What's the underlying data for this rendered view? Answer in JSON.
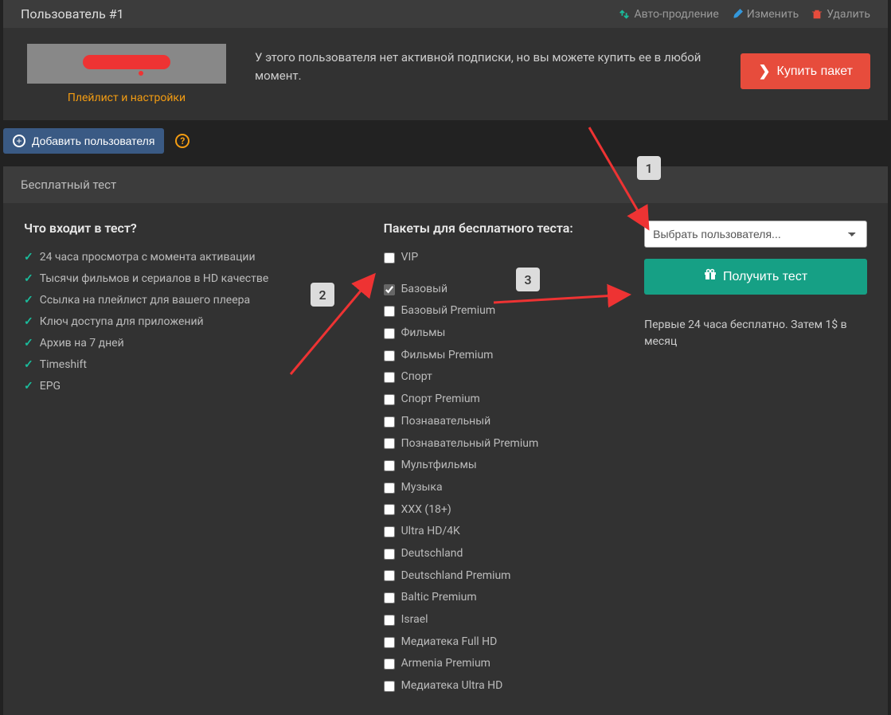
{
  "user": {
    "title": "Пользователь #1",
    "links": {
      "auto": "Авто-продление",
      "edit": "Изменить",
      "delete": "Удалить"
    },
    "playlist_link": "Плейлист и настройки",
    "subscription_text": "У этого пользователя нет активной подписки, но вы можете купить ее в любой момент.",
    "buy_label": "Купить пакет"
  },
  "add_user_label": "Добавить пользователя",
  "test": {
    "header": "Бесплатный тест",
    "includes_title": "Что входит в тест?",
    "features": [
      "24 часа просмотра с момента активации",
      "Тысячи фильмов и сериалов в HD качестве",
      "Ссылка на плейлист для вашего плеера",
      "Ключ доступа для приложений",
      "Архив на 7 дней",
      "Timeshift",
      "EPG"
    ],
    "packages_title": "Пакеты для бесплатного теста:",
    "packages": [
      {
        "label": "VIP",
        "checked": false
      },
      {
        "label": "Базовый",
        "checked": true
      },
      {
        "label": "Базовый Premium",
        "checked": false
      },
      {
        "label": "Фильмы",
        "checked": false
      },
      {
        "label": "Фильмы Premium",
        "checked": false
      },
      {
        "label": "Спорт",
        "checked": false
      },
      {
        "label": "Спорт Premium",
        "checked": false
      },
      {
        "label": "Познавательный",
        "checked": false
      },
      {
        "label": "Познавательный Premium",
        "checked": false
      },
      {
        "label": "Мультфильмы",
        "checked": false
      },
      {
        "label": "Музыка",
        "checked": false
      },
      {
        "label": "XXX (18+)",
        "checked": false
      },
      {
        "label": "Ultra HD/4K",
        "checked": false
      },
      {
        "label": "Deutschland",
        "checked": false
      },
      {
        "label": "Deutschland Premium",
        "checked": false
      },
      {
        "label": "Baltic Premium",
        "checked": false
      },
      {
        "label": "Israel",
        "checked": false
      },
      {
        "label": "Медиатека Full HD",
        "checked": false
      },
      {
        "label": "Armenia Premium",
        "checked": false
      },
      {
        "label": "Медиатека Ultra HD",
        "checked": false
      }
    ],
    "select_placeholder": "Выбрать пользователя...",
    "get_test_label": "Получить тест",
    "note": "Первые 24 часа бесплатно. Затем 1$ в месяц"
  },
  "markers": {
    "m1": "1",
    "m2": "2",
    "m3": "3"
  }
}
